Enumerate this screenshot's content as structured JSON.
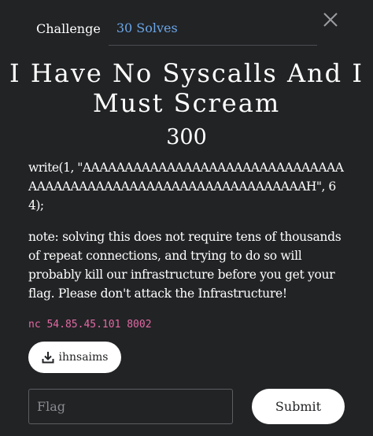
{
  "tabs": {
    "challenge": "Challenge",
    "solves": "30 Solves"
  },
  "challenge": {
    "title": "I Have No Syscalls And I Must Scream",
    "points": "300",
    "description": "write(1, \"AAAAAAAAAAAAAAAAAAAAAAAAAAAAAAAAAAAAAAAAAAAAAAAAAAAAAAAAAAAAAAAAH\", 64);",
    "note": "note: solving this does not require tens of thousands of repeat connections, and trying to do so will probably kill our infrastructure before you get your flag. Please don't attack the Infrastructure!",
    "connection": "nc 54.85.45.101 8002",
    "file_label": "ihnsaims"
  },
  "form": {
    "flag_placeholder": "Flag",
    "flag_value": "",
    "submit_label": "Submit"
  },
  "icons": {
    "close": "close-icon",
    "download": "download-icon"
  },
  "colors": {
    "background": "#222325",
    "link": "#6aa6e8",
    "connection": "#e26aa4",
    "button": "#ffffff"
  }
}
